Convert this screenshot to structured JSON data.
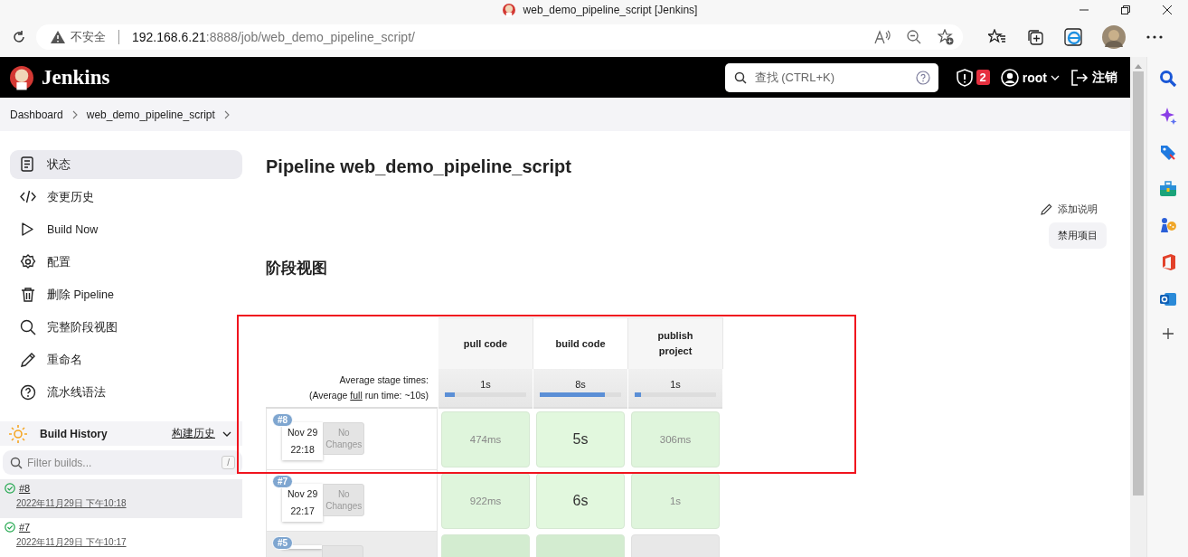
{
  "window": {
    "title": "web_demo_pipeline_script [Jenkins]"
  },
  "address_bar": {
    "security": "不安全",
    "host": "192.168.6.21",
    "path": ":8888/job/web_demo_pipeline_script/"
  },
  "header": {
    "brand": "Jenkins",
    "search": {
      "placeholder": "查找 (CTRL+K)"
    },
    "alerts": "2",
    "user": "root",
    "logout": "注销"
  },
  "breadcrumbs": [
    "Dashboard",
    "web_demo_pipeline_script"
  ],
  "side_menu": [
    {
      "label": "状态",
      "selected": true
    },
    {
      "label": "变更历史",
      "selected": false
    },
    {
      "label": "Build Now",
      "selected": false
    },
    {
      "label": "配置",
      "selected": false
    },
    {
      "label": "删除 Pipeline",
      "selected": false
    },
    {
      "label": "完整阶段视图",
      "selected": false
    },
    {
      "label": "重命名",
      "selected": false
    },
    {
      "label": "流水线语法",
      "selected": false
    }
  ],
  "build_history": {
    "title": "Build History",
    "trend_link": "构建历史",
    "filter": {
      "placeholder": "Filter builds...",
      "shortcut": "/"
    },
    "builds": [
      {
        "number": "#8",
        "time": "2022年11月29日 下午10:18",
        "selected": true
      },
      {
        "number": "#7",
        "time": "2022年11月29日 下午10:17",
        "selected": false
      }
    ]
  },
  "page_title": "Pipeline web_demo_pipeline_script",
  "actions": {
    "add_description": "添加说明",
    "disable": "禁用项目"
  },
  "stage_view": {
    "title": "阶段视图",
    "stages": [
      "pull code",
      "build code",
      "publish project"
    ],
    "averages_label": "Average stage times:",
    "note_before": "(Average",
    "note_link": "full",
    "note_after": "run time: ~10s)",
    "averages": [
      {
        "time": "1s",
        "level": 0.12
      },
      {
        "time": "8s",
        "level": 0.8
      },
      {
        "time": "1s",
        "level": 0.08
      }
    ],
    "runs": [
      {
        "number": "#8",
        "date": "Nov 29",
        "time": "22:18",
        "changes": "No Changes",
        "hovered": false,
        "cells": [
          {
            "kind": "success",
            "duration": "474ms",
            "prominent": false
          },
          {
            "kind": "success",
            "duration": "5s",
            "prominent": true
          },
          {
            "kind": "success",
            "duration": "306ms",
            "prominent": false
          }
        ]
      },
      {
        "number": "#7",
        "date": "Nov 29",
        "time": "22:17",
        "changes": "No Changes",
        "hovered": false,
        "cells": [
          {
            "kind": "success",
            "duration": "922ms",
            "prominent": false
          },
          {
            "kind": "success",
            "duration": "6s",
            "prominent": true
          },
          {
            "kind": "success",
            "duration": "1s",
            "prominent": false
          }
        ]
      },
      {
        "number": "#5",
        "hovered": true,
        "cells": [
          {
            "kind": "success"
          },
          {
            "kind": "success"
          },
          {
            "kind": "empty"
          }
        ]
      }
    ]
  }
}
